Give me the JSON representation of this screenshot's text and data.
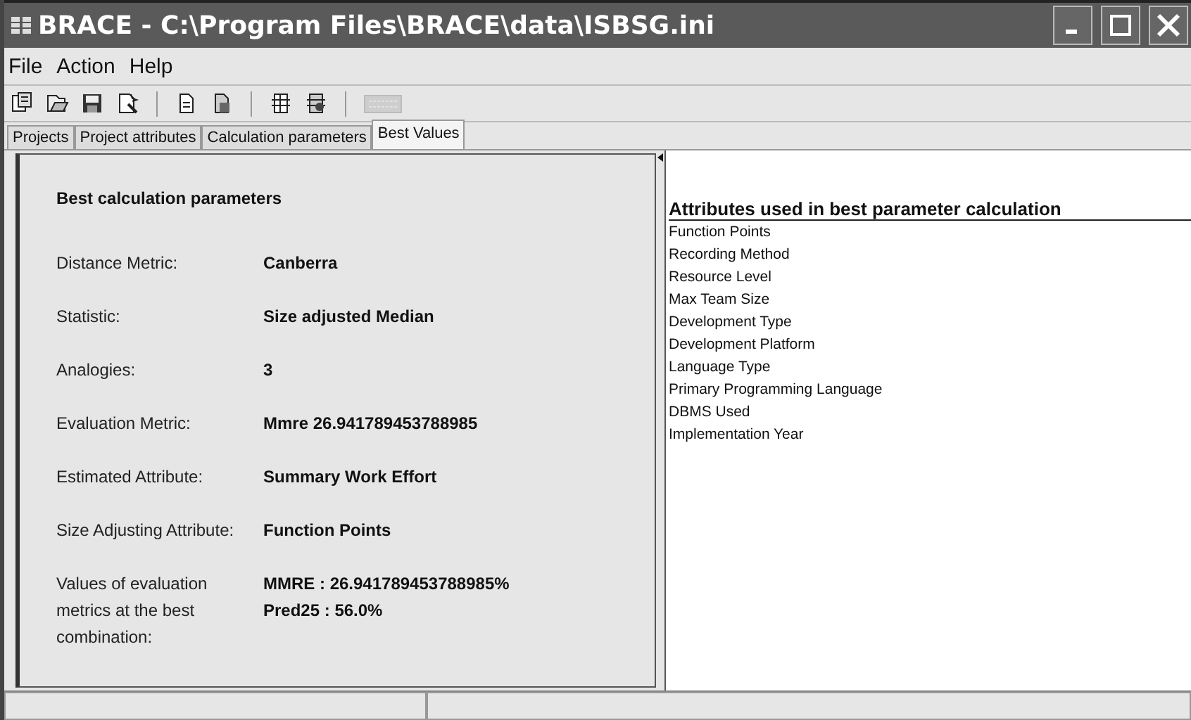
{
  "window": {
    "title": "BRACE - C:\\Program Files\\BRACE\\data\\ISBSG.ini"
  },
  "menu": [
    "File",
    "Action",
    "Help"
  ],
  "toolbar": [
    {
      "kind": "paste",
      "disabled": false
    },
    {
      "kind": "open",
      "disabled": false
    },
    {
      "kind": "save",
      "disabled": false
    },
    {
      "kind": "wizard",
      "disabled": false
    },
    {
      "kind": "separator"
    },
    {
      "kind": "page",
      "disabled": false
    },
    {
      "kind": "pages",
      "disabled": false
    },
    {
      "kind": "separator"
    },
    {
      "kind": "sheet",
      "disabled": false
    },
    {
      "kind": "sheets",
      "disabled": false
    },
    {
      "kind": "separator"
    },
    {
      "kind": "keyboard",
      "disabled": true
    }
  ],
  "tabs": [
    {
      "label": "Projects",
      "selected": false
    },
    {
      "label": "Project attributes",
      "selected": false
    },
    {
      "label": "Calculation parameters",
      "selected": false
    },
    {
      "label": "Best Values",
      "selected": true
    }
  ],
  "best": {
    "title": "Best calculation parameters",
    "rows": [
      {
        "label": "Distance Metric:",
        "value": [
          "Canberra"
        ]
      },
      {
        "label": "Statistic:",
        "value": [
          "Size adjusted Median"
        ]
      },
      {
        "label": "Analogies:",
        "value": [
          "3"
        ]
      },
      {
        "label": "Evaluation Metric:",
        "value": [
          "Mmre 26.941789453788985"
        ]
      },
      {
        "label": "Estimated Attribute:",
        "value": [
          "Summary Work Effort"
        ]
      },
      {
        "label": "Size Adjusting Attribute:",
        "value": [
          "Function Points"
        ]
      },
      {
        "label": "Values of evaluation metrics at the best combination:",
        "value": [
          "MMRE : 26.941789453788985%",
          "Pred25 : 56.0%"
        ]
      }
    ]
  },
  "attributes": {
    "title": "Attributes used in best parameter calculation",
    "items": [
      "Function Points",
      "Recording Method",
      "Resource Level",
      "Max Team Size",
      "Development Type",
      "Development Platform",
      "Language Type",
      "Primary Programming Language",
      "DBMS Used",
      "Implementation Year"
    ]
  }
}
